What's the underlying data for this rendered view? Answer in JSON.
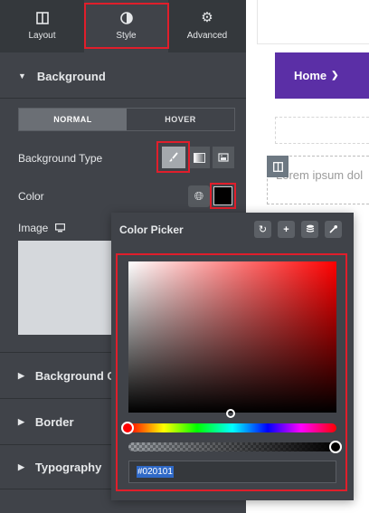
{
  "tabs": [
    {
      "label": "Layout",
      "icon": "layout-icon"
    },
    {
      "label": "Style",
      "icon": "style-icon"
    },
    {
      "label": "Advanced",
      "icon": "gear-icon"
    }
  ],
  "background_section": {
    "title": "Background",
    "state_tabs": [
      "NORMAL",
      "HOVER"
    ],
    "active_state": "NORMAL",
    "background_type_label": "Background Type",
    "background_types": [
      "classic-brush-icon",
      "gradient-icon",
      "video-icon"
    ],
    "active_type": "classic-brush-icon",
    "color_label": "Color",
    "color_value": "#020101",
    "image_label": "Image",
    "image_device_icon": "desktop-icon"
  },
  "collapsed_sections": [
    "Background O",
    "Border",
    "Typography"
  ],
  "color_picker": {
    "title": "Color Picker",
    "buttons": [
      "reset-icon",
      "add-icon",
      "global-colors-icon",
      "eyedropper-icon"
    ],
    "hex_value": "#020101",
    "hue_color": "#ff0000",
    "alpha": 1
  },
  "preview": {
    "menu_label": "Home",
    "lorem": "Lorem ipsum dol"
  }
}
